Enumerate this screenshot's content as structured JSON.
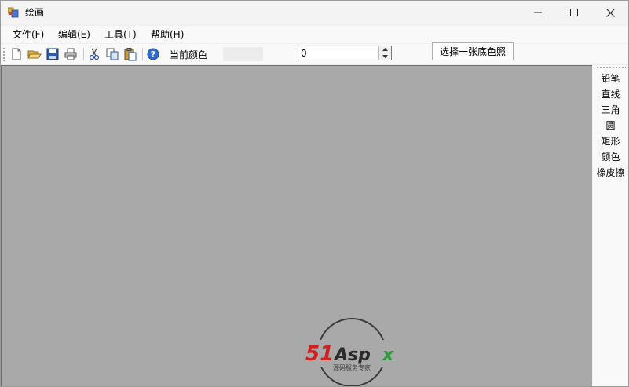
{
  "window": {
    "title": "绘画",
    "controls": {
      "minimize": "minimize-icon",
      "maximize": "maximize-icon",
      "close": "close-icon"
    }
  },
  "menu": {
    "items": [
      {
        "label": "文件(F)"
      },
      {
        "label": "编辑(E)"
      },
      {
        "label": "工具(T)"
      },
      {
        "label": "帮助(H)"
      }
    ]
  },
  "toolbar": {
    "icons": [
      "new-file-icon",
      "open-folder-icon",
      "save-icon",
      "print-icon",
      "cut-icon",
      "copy-icon",
      "paste-icon",
      "help-icon"
    ],
    "current_color_label": "当前颜色",
    "current_color": "#ececec",
    "spinner_value": "0",
    "background_button_label": "选择一张底色照"
  },
  "canvas": {
    "background": "#a9a9a9"
  },
  "tools": {
    "items": [
      {
        "label": "铅笔"
      },
      {
        "label": "直线"
      },
      {
        "label": "三角"
      },
      {
        "label": "圆"
      },
      {
        "label": "矩形"
      },
      {
        "label": "颜色"
      },
      {
        "label": "橡皮擦"
      }
    ]
  },
  "watermark": {
    "brand": "51Aspx",
    "tagline": "源码服务专家"
  }
}
